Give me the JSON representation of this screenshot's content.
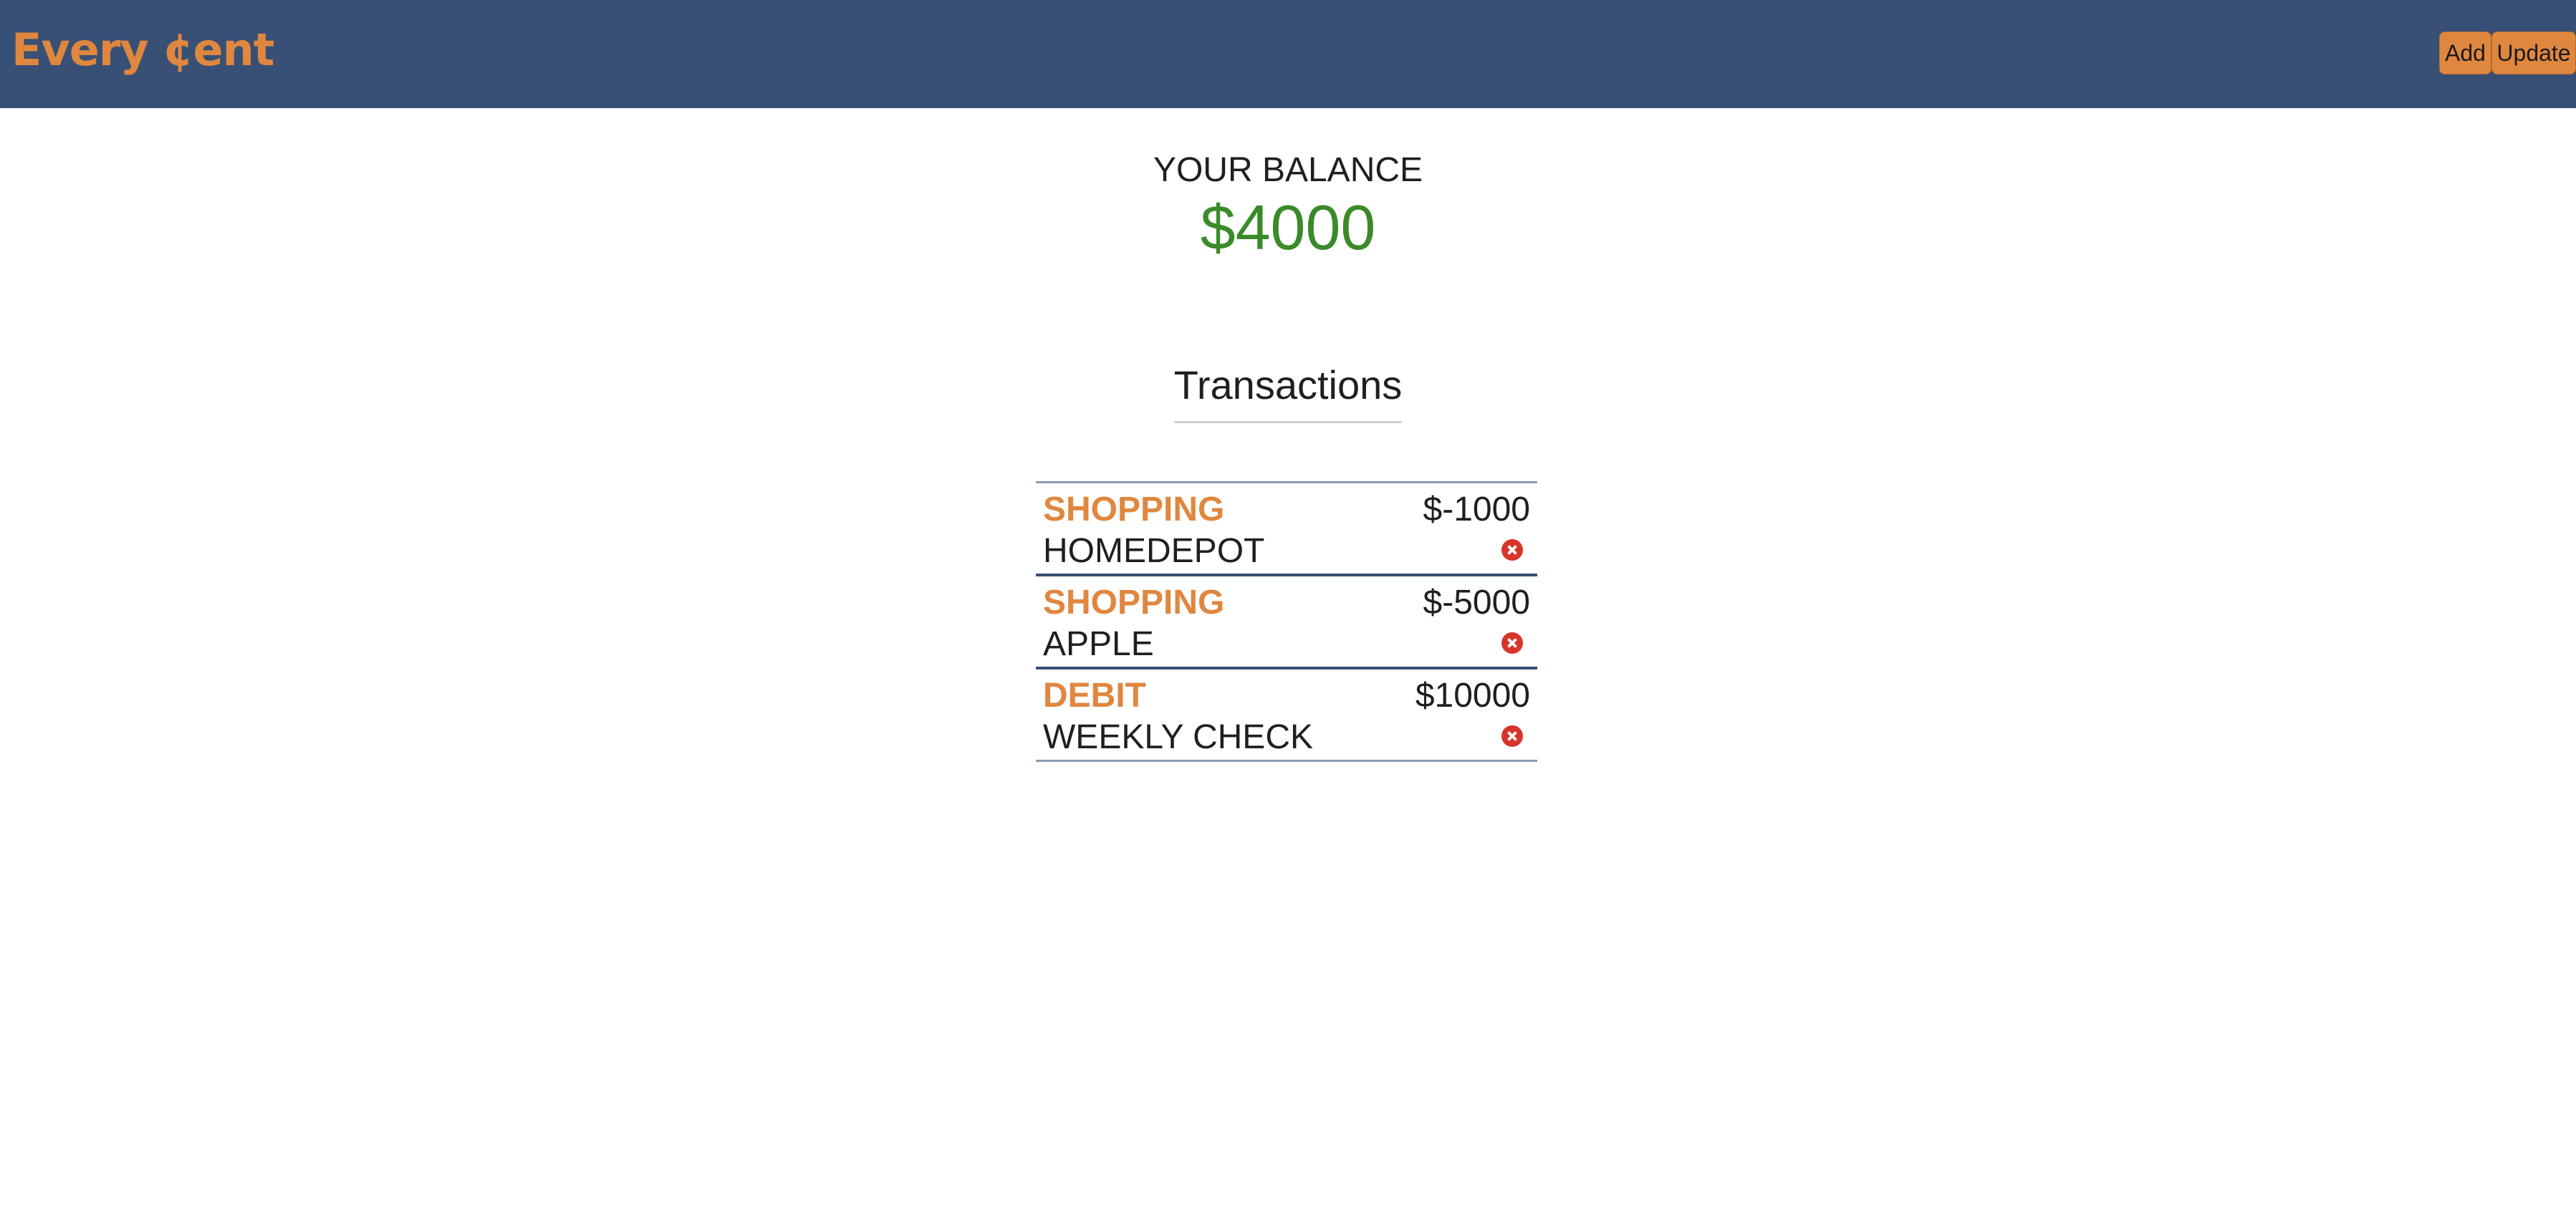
{
  "navbar": {
    "brand": "Every ¢ent",
    "buttons": {
      "add_label": "Add",
      "update_label": "Update"
    },
    "colors": {
      "background": "#385075",
      "accent": "#e0873f"
    }
  },
  "balance": {
    "label": "YOUR BALANCE",
    "amount": "$4000",
    "amount_color": "#3a8a2a"
  },
  "transactions": {
    "heading": "Transactions",
    "items": [
      {
        "category": "SHOPPING",
        "name": "HOMEDEPOT",
        "amount": "$-1000",
        "delete_icon": "close-circle-icon"
      },
      {
        "category": "SHOPPING",
        "name": "APPLE",
        "amount": "$-5000",
        "delete_icon": "close-circle-icon"
      },
      {
        "category": "DEBIT",
        "name": "WEEKLY CHECK",
        "amount": "$10000",
        "delete_icon": "close-circle-icon"
      }
    ]
  }
}
